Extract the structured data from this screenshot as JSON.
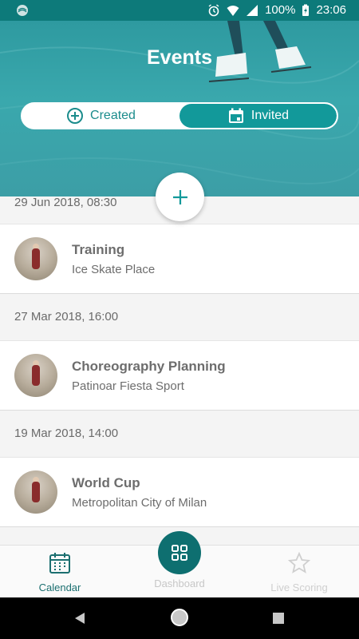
{
  "status_bar": {
    "battery": "100%",
    "time": "23:06"
  },
  "header": {
    "title": "Events",
    "tabs": [
      {
        "label": "Created",
        "icon": "plus-circle-icon",
        "selected": false
      },
      {
        "label": "Invited",
        "icon": "calendar-icon",
        "selected": true
      }
    ]
  },
  "fab": {
    "icon": "plus-icon"
  },
  "events": [
    {
      "date": "29 Jun 2018, 08:30",
      "title": "Training",
      "location": "Ice Skate Place"
    },
    {
      "date": "27 Mar 2018, 16:00",
      "title": "Choreography Planning",
      "location": "Patinoar Fiesta Sport"
    },
    {
      "date": "19 Mar 2018, 14:00",
      "title": "World Cup",
      "location": "Metropolitan City of Milan"
    }
  ],
  "bottom_nav": {
    "calendar": "Calendar",
    "dashboard": "Dashboard",
    "live_scoring": "Live Scoring"
  },
  "colors": {
    "teal": "#12999a",
    "dark_teal": "#0e6f70",
    "status_bar": "#0d7a7a"
  }
}
